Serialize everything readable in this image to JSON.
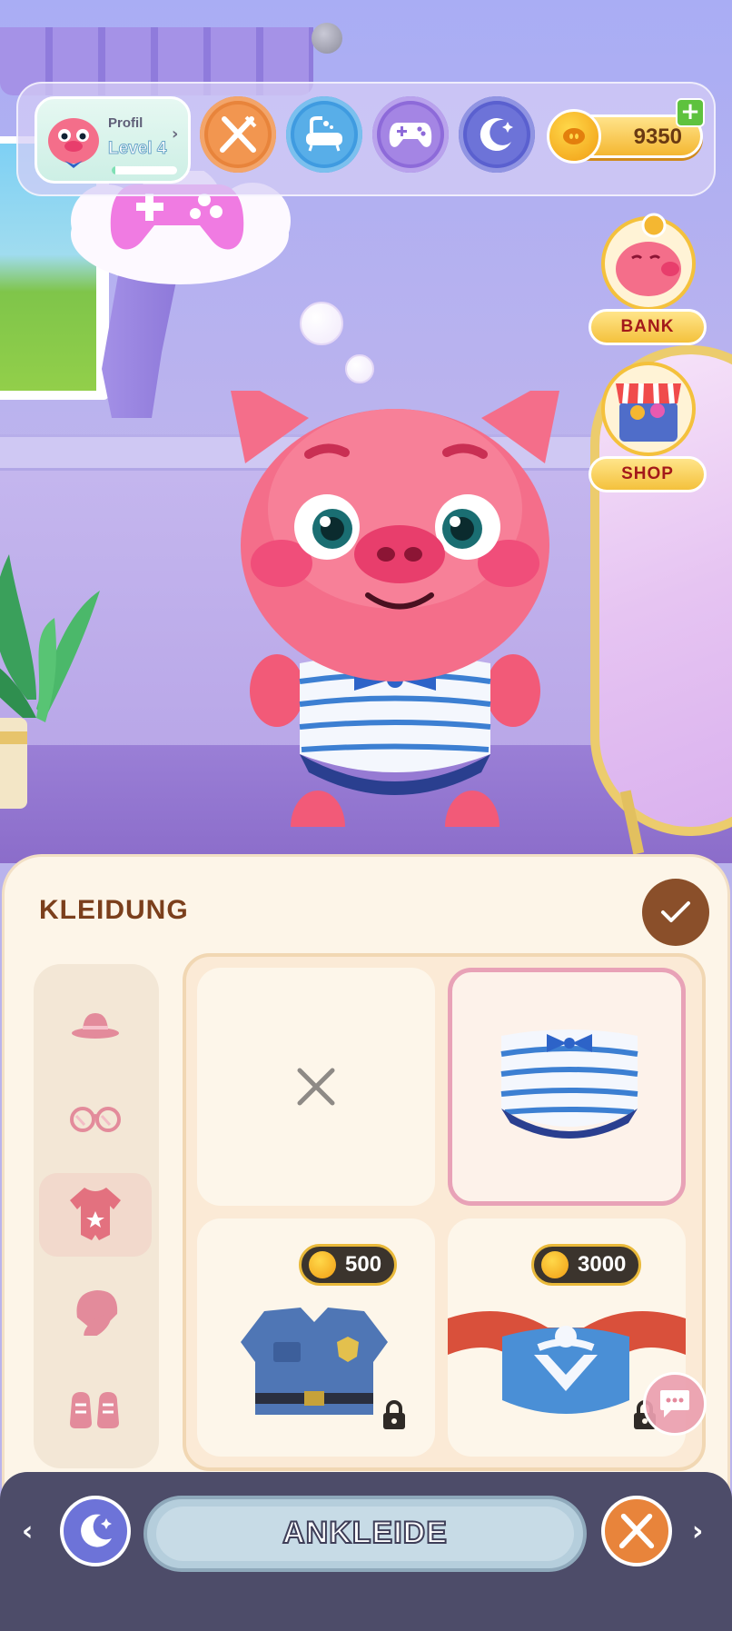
{
  "hud": {
    "profile": {
      "title": "Profil",
      "level": "Level 4",
      "xp_progress": 0.05
    },
    "needs": [
      {
        "name": "food",
        "icon": "fork-knife-icon",
        "color": "#e8843b"
      },
      {
        "name": "bath",
        "icon": "bathtub-icon",
        "color": "#3f9be0"
      },
      {
        "name": "play",
        "icon": "gamepad-icon",
        "color": "#8d6ad9"
      },
      {
        "name": "sleep",
        "icon": "moon-icon",
        "color": "#5a60cf"
      }
    ],
    "coins": "9350"
  },
  "side_buttons": {
    "bank": "BANK",
    "shop": "SHOP"
  },
  "thought_icon": "gamepad-icon",
  "wardrobe": {
    "title": "KLEIDUNG",
    "categories": [
      "hat-icon",
      "glasses-icon",
      "onesie-icon",
      "beanie-icon",
      "shoes-icon"
    ],
    "active_category": "onesie-icon",
    "items": [
      {
        "name": "none",
        "price": null,
        "locked": false
      },
      {
        "name": "sailor-outfit",
        "price": null,
        "locked": false,
        "selected": true
      },
      {
        "name": "police-outfit",
        "price": "500",
        "locked": true
      },
      {
        "name": "superhero-outfit",
        "price": "3000",
        "locked": true
      }
    ]
  },
  "bottom_nav": {
    "label": "ANKLEIDE",
    "left_icon": "moon-icon",
    "right_icon": "fork-knife-icon"
  },
  "colors": {
    "panel": "#fdf5e8",
    "title": "#7b3f1c",
    "nav": "#4d4c69",
    "selected_border": "#e8a2b7"
  }
}
